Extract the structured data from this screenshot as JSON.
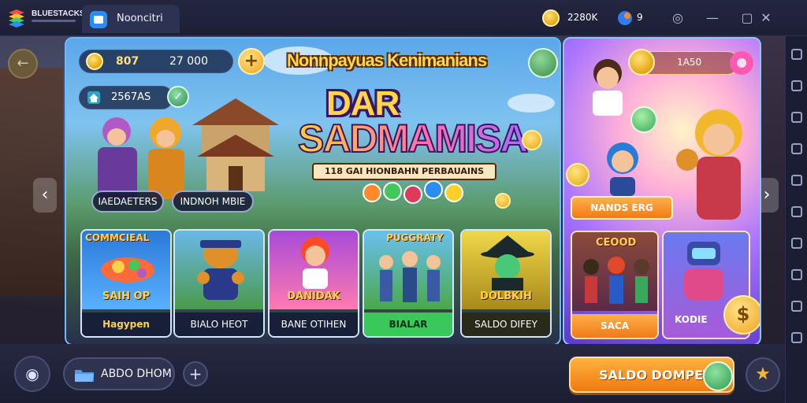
{
  "titlebar": {
    "brand_name": "BLUESTACKS",
    "app_tab_label": "Nooncitri",
    "coins": "2280K",
    "gems": "9"
  },
  "panel": {
    "coin_amount": "807",
    "balance": "27 000",
    "gem_value": "2567AS",
    "header_title": "Nonnpayuas Kenimanians",
    "logo_line1": "DAR",
    "logo_line2": "SADMAMISA",
    "logo_ribbon": "118 GAI HIONBAHN PERBAUAINS",
    "hero_buttons": [
      "IAEDAETERS",
      "INDNOH MBIE"
    ],
    "cards": [
      {
        "top_title": "COMMCIEAL",
        "bottom_title": "SAIH OP",
        "label": "Hagypen"
      },
      {
        "top_title": "",
        "bottom_title": "",
        "label": "BIALO HEOT"
      },
      {
        "top_title": "",
        "bottom_title": "DANIDAK",
        "label": "BANE OTIHEN"
      },
      {
        "top_title": "PUGGRATY",
        "bottom_title": "",
        "label": "BIALAR"
      },
      {
        "top_title": "",
        "bottom_title": "DOLBKIH",
        "label": "SALDO DIFEY"
      }
    ]
  },
  "promo": {
    "top_value": "1A50",
    "mid_button": "NANDS ERG",
    "cards": [
      {
        "title": "CEOOD",
        "label": "SACA"
      },
      {
        "title": "",
        "label": "KODIE"
      }
    ]
  },
  "bottombar": {
    "add_label": "ABDO DHOM",
    "cta_label": "SALDO DOMPET"
  },
  "colors": {
    "cta": "#f59a24",
    "panel_border": "#6fb8ff",
    "app_tab_icon": "#2a8df5",
    "gold": "#ffd24a"
  },
  "icons": [
    "brand-logo",
    "app-icon",
    "coin-icon",
    "gem-icon",
    "help-icon",
    "minimize-icon",
    "close-icon",
    "plus-icon",
    "leaf-icon",
    "camera-icon",
    "folder-icon",
    "star-icon",
    "back-arrow-icon"
  ]
}
